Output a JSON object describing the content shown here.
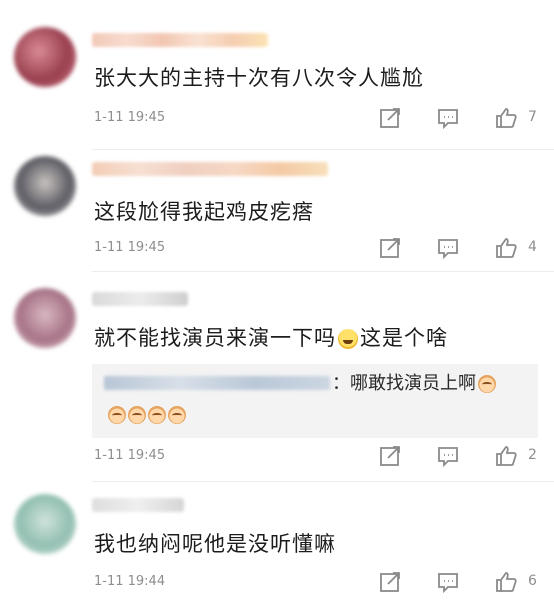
{
  "comments": [
    {
      "text": "张大大的主持十次有八次令人尴尬",
      "time": "1-11 19:45",
      "likes": "7",
      "actions": {
        "share_icon": "share-icon",
        "reply_icon": "comment-icon",
        "like_icon": "thumbs-up-icon"
      }
    },
    {
      "text": "这段尬得我起鸡皮疙瘩",
      "time": "1-11 19:45",
      "likes": "4",
      "actions": {
        "share_icon": "share-icon",
        "reply_icon": "comment-icon",
        "like_icon": "thumbs-up-icon"
      }
    },
    {
      "text_before_emoji": "就不能找演员来演一下吗",
      "text_after_emoji": "这是个啥",
      "emoji": "laugh-cry-emoji",
      "time": "1-11 19:45",
      "likes": "2",
      "reply": {
        "text": "：哪敢找演员上啊",
        "emoji": "doge-emoji",
        "emoji_row_count": 4
      },
      "actions": {
        "share_icon": "share-icon",
        "reply_icon": "comment-icon",
        "like_icon": "thumbs-up-icon"
      }
    },
    {
      "text": "我也纳闷呢他是没听懂嘛",
      "time": "1-11 19:44",
      "likes": "6",
      "actions": {
        "share_icon": "share-icon",
        "reply_icon": "comment-icon",
        "like_icon": "thumbs-up-icon"
      }
    }
  ],
  "colors": {
    "text": "#1c1c1c",
    "meta": "#8e8e8e",
    "icon": "#8a8a8a",
    "reply_bg": "#f3f3f3"
  }
}
